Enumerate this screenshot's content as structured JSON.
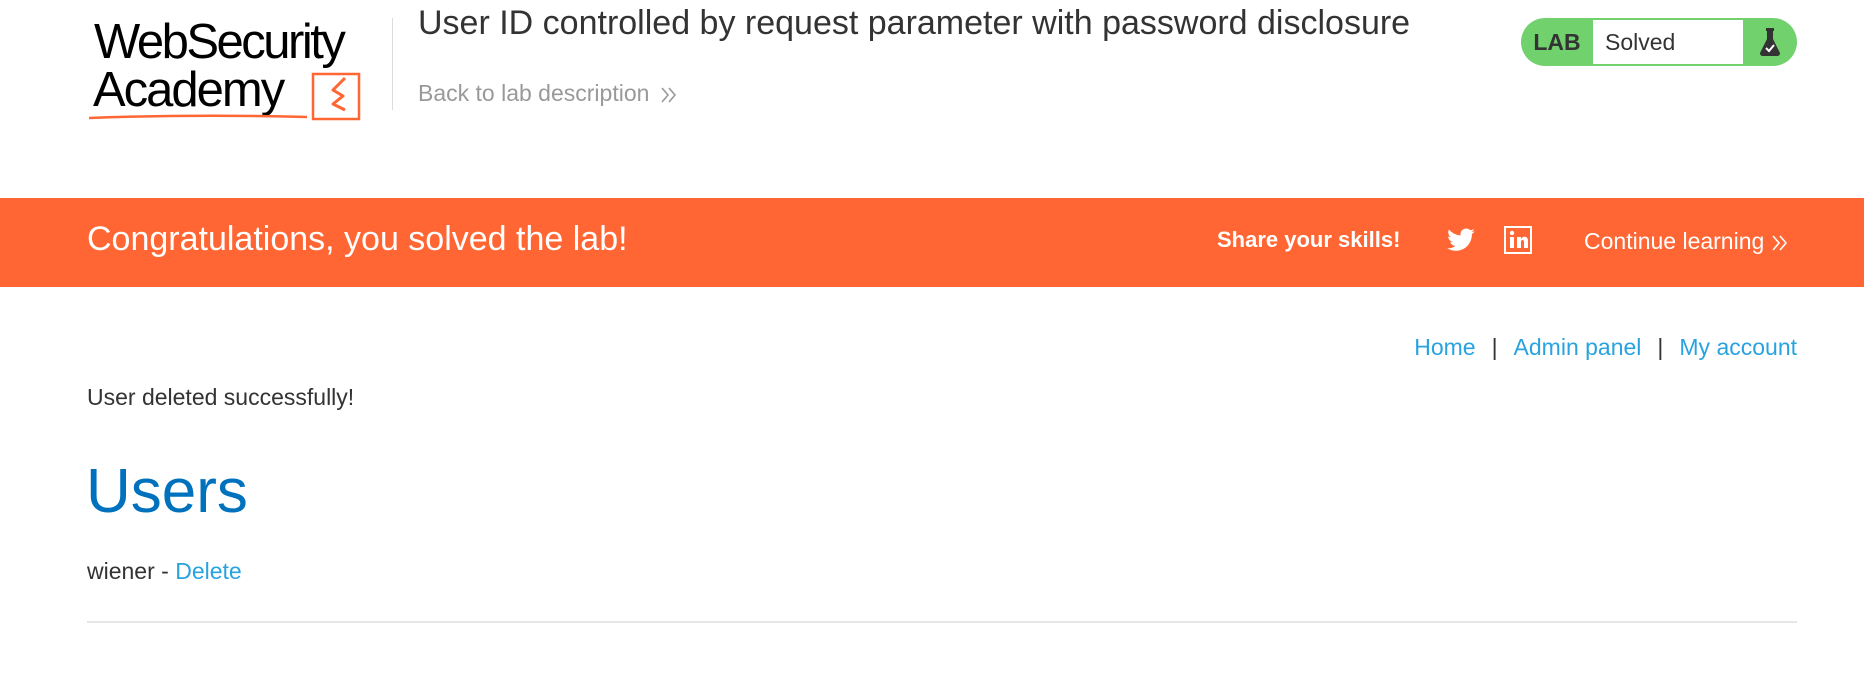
{
  "header": {
    "logo": {
      "line1": "WebSecurity",
      "line2": "Academy"
    },
    "lab_title": "User ID controlled by request parameter with password disclosure",
    "back_link": "Back to lab description",
    "status": {
      "badge": "LAB",
      "value": "Solved",
      "icon": "flask-icon"
    }
  },
  "banner": {
    "message": "Congratulations, you solved the lab!",
    "share_label": "Share your skills!",
    "social_icons": [
      "twitter-icon",
      "linkedin-icon"
    ],
    "continue_link": "Continue learning"
  },
  "nav": {
    "links": [
      "Home",
      "Admin panel",
      "My account"
    ],
    "separator": "|"
  },
  "main": {
    "notice": "User deleted successfully!",
    "heading": "Users",
    "users": [
      {
        "name": "wiener",
        "separator": " - ",
        "action": "Delete"
      }
    ]
  },
  "colors": {
    "banner": "#ff6633",
    "status_green": "#70d16d",
    "link": "#29a3e0",
    "heading": "#0071bc",
    "text": "#333333"
  }
}
